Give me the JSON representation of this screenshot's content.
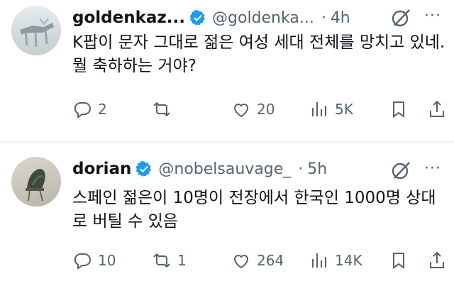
{
  "tweets": [
    {
      "name": "goldenkaz...",
      "handle": "@goldenka...",
      "separator": "·",
      "time": "4h",
      "more": "···",
      "text": "K팝이 문자 그대로 젊은 여성 세대 전체를 망치고 있네. 뭘 축하하는 거야?",
      "replies": "2",
      "retweets": "",
      "likes": "20",
      "views": "5K"
    },
    {
      "name": "dorian",
      "handle": "@nobelsauvage_",
      "separator": "·",
      "time": "5h",
      "more": "···",
      "text": "스페인 젊은이 10명이 전장에서 한국인 1000명 상대로 버틸 수 있음",
      "replies": "10",
      "retweets": "1",
      "likes": "264",
      "views": "14K"
    }
  ],
  "colors": {
    "verified": "#1d9bf0",
    "secondary": "#536471",
    "text": "#0f1419"
  },
  "icons": [
    "reply-icon",
    "retweet-icon",
    "like-icon",
    "views-icon",
    "bookmark-icon",
    "share-icon",
    "grok-icon",
    "verified-badge-icon"
  ]
}
